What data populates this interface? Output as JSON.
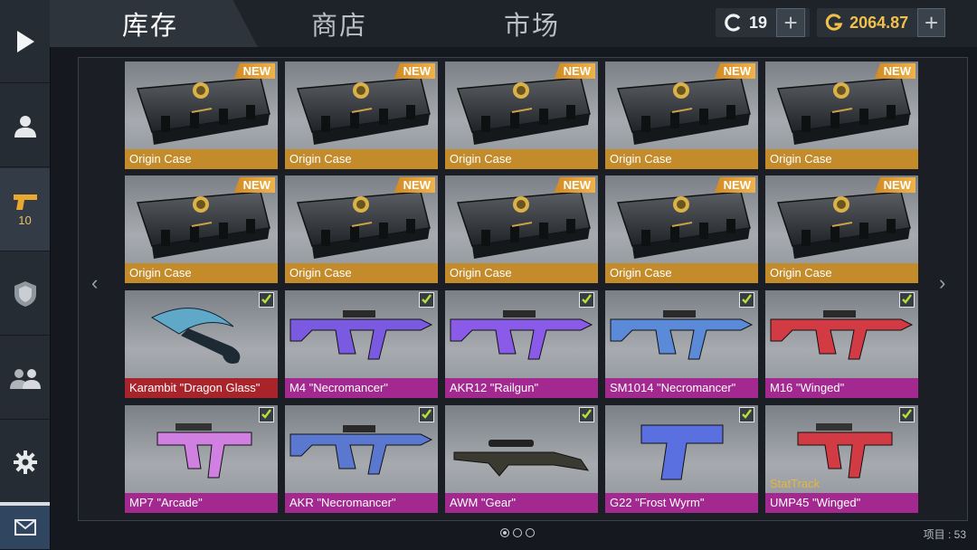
{
  "sidebar": {
    "items": [
      {
        "icon": "play-icon"
      },
      {
        "icon": "profile-icon"
      },
      {
        "icon": "pistol-icon",
        "count": "10"
      },
      {
        "icon": "shield-badge-icon"
      },
      {
        "icon": "friends-icon"
      },
      {
        "icon": "gear-icon"
      },
      {
        "icon": "mail-icon"
      }
    ]
  },
  "tabs": [
    "库存",
    "商店",
    "市场"
  ],
  "currency": {
    "credits": "19",
    "gold": "2064.87"
  },
  "grid": {
    "badge_new": "NEW",
    "stattrack": "StatTrack",
    "cases": [
      "Origin Case",
      "Origin Case",
      "Origin Case",
      "Origin Case",
      "Origin Case",
      "Origin Case",
      "Origin Case",
      "Origin Case",
      "Origin Case",
      "Origin Case"
    ],
    "weapons_row3": [
      "Karambit \"Dragon Glass\"",
      "M4 \"Necromancer\"",
      "AKR12 \"Railgun\"",
      "SM1014 \"Necromancer\"",
      "M16 \"Winged\""
    ],
    "weapons_row4": [
      "MP7 \"Arcade\"",
      "AKR \"Necromancer\"",
      "AWM \"Gear\"",
      "G22 \"Frost Wyrm\"",
      "UMP45 \"Winged\""
    ]
  },
  "nav": {
    "prev": "‹",
    "next": "›"
  },
  "footer": {
    "items_label": "项目 : 53"
  },
  "colors": {
    "case_label": "#c48b2b",
    "red_label": "#a8232a",
    "purple_label": "#a3288f",
    "accent_gold": "#e8c06a"
  }
}
